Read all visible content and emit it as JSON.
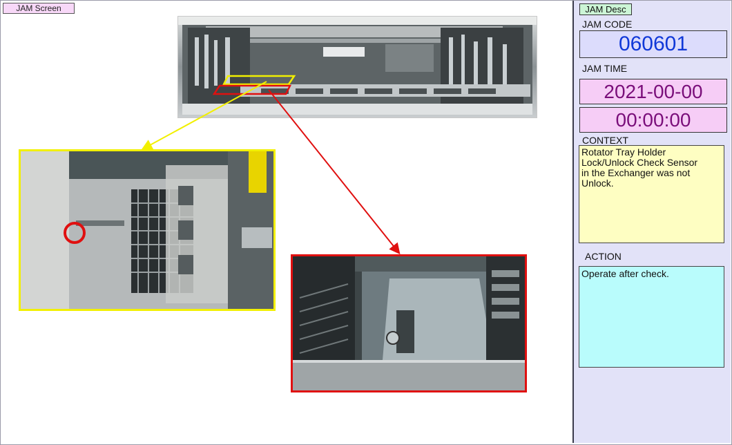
{
  "main": {
    "tab_label": "JAM Screen",
    "images": [
      {
        "name": "machine-overview-photo",
        "highlight_colors": [
          "#f2f000",
          "#e01010"
        ]
      },
      {
        "name": "tray-holder-detail-photo",
        "frame_color": "#f2f000",
        "marker": "red-circle"
      },
      {
        "name": "exchanger-detail-photo",
        "frame_color": "#e01010"
      }
    ]
  },
  "side": {
    "tab_label": "JAM Desc",
    "code_label": "JAM CODE",
    "code_value": "060601",
    "time_label": "JAM TIME",
    "date_value": "2021-00-00",
    "time_value": "00:00:00",
    "context_label": "CONTEXT",
    "context_text": "Rotator Tray Holder\nLock/Unlock Check Sensor\nin the Exchanger was not\nUnlock.",
    "action_label": "ACTION",
    "action_text": "Operate after check."
  },
  "colors": {
    "code_text": "#1038d8",
    "time_text": "#7a0e7a",
    "context_bg": "#fefec2",
    "action_bg": "#b9fcfc",
    "panel_bg": "#e2e2f8"
  }
}
